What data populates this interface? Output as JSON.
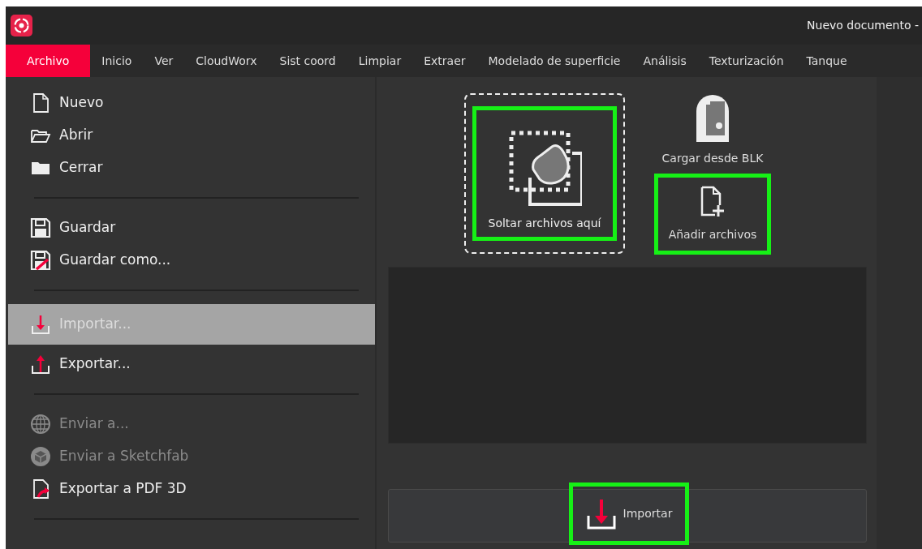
{
  "window": {
    "title": "Nuevo documento -"
  },
  "menu_tabs": [
    {
      "label": "Archivo",
      "selected": true
    },
    {
      "label": "Inicio",
      "selected": false
    },
    {
      "label": "Ver",
      "selected": false
    },
    {
      "label": "CloudWorx",
      "selected": false
    },
    {
      "label": "Sist coord",
      "selected": false
    },
    {
      "label": "Limpiar",
      "selected": false
    },
    {
      "label": "Extraer",
      "selected": false
    },
    {
      "label": "Modelado de superficie",
      "selected": false
    },
    {
      "label": "Análisis",
      "selected": false
    },
    {
      "label": "Texturización",
      "selected": false
    },
    {
      "label": "Tanque",
      "selected": false
    }
  ],
  "file_menu": [
    {
      "kind": "item",
      "label": "Nuevo",
      "selected": false,
      "disabled": false
    },
    {
      "kind": "item",
      "label": "Abrir",
      "selected": false,
      "disabled": false
    },
    {
      "kind": "item",
      "label": "Cerrar",
      "selected": false,
      "disabled": false
    },
    {
      "kind": "separator"
    },
    {
      "kind": "item",
      "label": "Guardar",
      "selected": false,
      "disabled": false
    },
    {
      "kind": "item",
      "label": "Guardar como...",
      "selected": false,
      "disabled": false
    },
    {
      "kind": "separator"
    },
    {
      "kind": "item",
      "label": "Importar...",
      "selected": true,
      "disabled": false
    },
    {
      "kind": "item",
      "label": "Exportar...",
      "selected": false,
      "disabled": false
    },
    {
      "kind": "separator"
    },
    {
      "kind": "item",
      "label": "Enviar a...",
      "selected": false,
      "disabled": true
    },
    {
      "kind": "item",
      "label": "Enviar a Sketchfab",
      "selected": false,
      "disabled": true
    },
    {
      "kind": "item",
      "label": "Exportar a PDF 3D",
      "selected": false,
      "disabled": false
    },
    {
      "kind": "separator"
    }
  ],
  "import_panel": {
    "drop_zone": {
      "label": "Soltar archivos aquí",
      "highlighted": true
    },
    "blk": {
      "label": "Cargar desde BLK"
    },
    "add_files": {
      "label": "Añadir archivos",
      "highlighted": true
    },
    "import_button": {
      "label": "Importar",
      "highlighted": true
    }
  }
}
